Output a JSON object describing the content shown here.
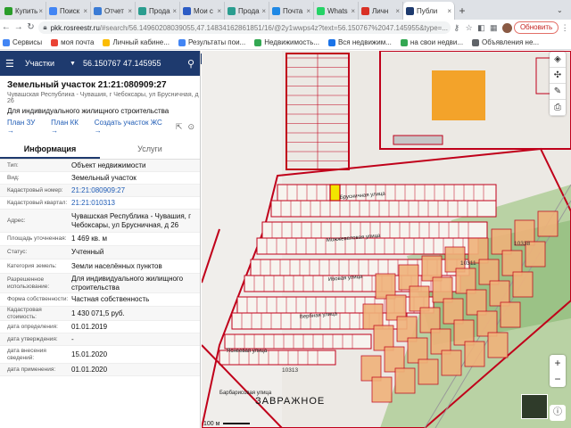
{
  "browser": {
    "tabs": [
      {
        "label": "Купить",
        "color": "#2a9d2a"
      },
      {
        "label": "Поиск",
        "color": "#4285f4"
      },
      {
        "label": "Отчет",
        "color": "#3a7bd5"
      },
      {
        "label": "Прода",
        "color": "#2a9d8f"
      },
      {
        "label": "Мои с",
        "color": "#2c5cc5"
      },
      {
        "label": "Прода",
        "color": "#2a9d8f"
      },
      {
        "label": "Почта",
        "color": "#1e88e5"
      },
      {
        "label": "Whats",
        "color": "#25d366"
      },
      {
        "label": "Личн",
        "color": "#d93025"
      },
      {
        "label": "Публи",
        "color": "#1e3a6e"
      }
    ],
    "url_host": "pkk.rosreestr.ru",
    "url_path": "/#search/56.14960208039055,47.14834162861851/16/@2y1wwps4z?text=56.150767%2047.145955&type=...",
    "update_label": "Обновить",
    "bookmarks": [
      {
        "label": "Сервисы",
        "color": "#4285f4"
      },
      {
        "label": "моя почта",
        "color": "#ea4335"
      },
      {
        "label": "Личный кабине...",
        "color": "#fbbc05"
      },
      {
        "label": "Результаты пои...",
        "color": "#4285f4"
      },
      {
        "label": "Недвижимость...",
        "color": "#34a853"
      },
      {
        "label": "Вся недвижим...",
        "color": "#1a73e8"
      },
      {
        "label": "на свои недви...",
        "color": "#34a853"
      },
      {
        "label": "Объявления не...",
        "color": "#5f6368"
      }
    ]
  },
  "search": {
    "layer": "Участки",
    "query": "56.150767 47.145955"
  },
  "object": {
    "title": "Земельный участок 21:21:080909:27",
    "address_short": "Чувашская Республика - Чувашия, г Чебоксары, ул Брусничная, д 26",
    "use": "Для индивидуального жилищного строительства",
    "links": [
      "План ЗУ",
      "План КК",
      "Создать участок ЖС"
    ],
    "tabs": [
      "Информация",
      "Услуги"
    ],
    "fields": [
      {
        "k": "Тип:",
        "v": "Объект недвижимости"
      },
      {
        "k": "Вид:",
        "v": "Земельный участок"
      },
      {
        "k": "Кадастровый номер:",
        "v": "21:21:080909:27"
      },
      {
        "k": "Кадастровый квартал:",
        "v": "21:21:010313"
      },
      {
        "k": "Адрес:",
        "v": "Чувашская Республика - Чувашия, г Чебоксары, ул Брусничная, д 26"
      },
      {
        "k": "Площадь уточненная:",
        "v": "1 469 кв. м"
      },
      {
        "k": "Статус:",
        "v": "Учтенный"
      },
      {
        "k": "Категория земель:",
        "v": "Земли населённых пунктов"
      },
      {
        "k": "Разрешенное использование:",
        "v": "Для индивидуального жилищного строительства"
      },
      {
        "k": "Форма собственности:",
        "v": "Частная собственность"
      },
      {
        "k": "Кадастровая стоимость:",
        "v": "1 430 071,5 руб."
      },
      {
        "k": "дата определения:",
        "v": "01.01.2019"
      },
      {
        "k": "дата утверждения:",
        "v": "-"
      },
      {
        "k": "дата внесения сведений:",
        "v": "15.01.2020"
      },
      {
        "k": "дата применения:",
        "v": "01.01.2020"
      }
    ]
  },
  "map": {
    "streets": [
      "Брусничная улица",
      "Можжевеловая улица",
      "Ивовая улица",
      "Вербная улица",
      "Яснеевая улица",
      "Барбарисовая улица"
    ],
    "settlement": "ЗАВРАЖНОЕ",
    "quarter_labels": [
      "10313",
      "10338",
      "10311"
    ],
    "scale": "100 м",
    "highlight_color": "#f2e600",
    "parcel_color": "#c0001a"
  }
}
